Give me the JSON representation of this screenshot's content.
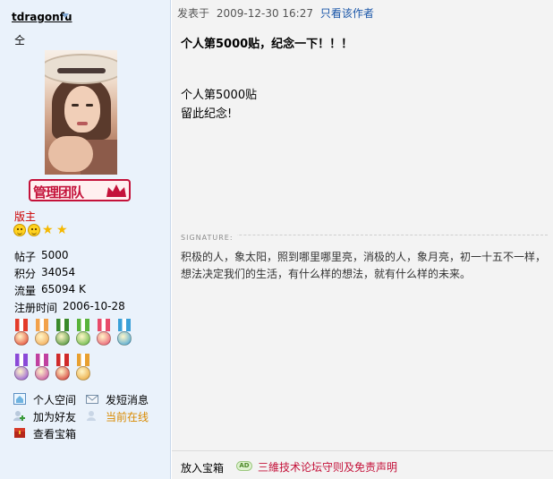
{
  "user": {
    "name": "tdragonfu",
    "status": "仝",
    "team_badge": "管理团队",
    "rank": "版主",
    "stats": [
      {
        "label": "帖子",
        "value": "5000"
      },
      {
        "label": "积分",
        "value": "34054"
      },
      {
        "label": "流量",
        "value": "65094 K"
      },
      {
        "label": "注册时间",
        "value": "2006-10-28"
      }
    ],
    "actions": [
      {
        "label": "个人空间",
        "icon": "home-icon"
      },
      {
        "label": "发短消息",
        "icon": "mail-icon"
      },
      {
        "label": "加为好友",
        "icon": "add-friend-icon"
      },
      {
        "label": "当前在线",
        "icon": "online-user-icon"
      },
      {
        "label": "查看宝箱",
        "icon": "treasure-box-icon"
      }
    ],
    "medals_row1": [
      "#e33b2a",
      "#f2a14a",
      "#3a8a2a",
      "#58b33a",
      "#e84a6a",
      "#3aa0d8"
    ],
    "medals_row2": [
      "#8a4ad8",
      "#c040a0",
      "#d02a2a",
      "#e8a030"
    ]
  },
  "post": {
    "meta_prefix": "发表于",
    "date": "2009-12-30 16:27",
    "only_author": "只看该作者",
    "title": "个人第5000贴，纪念一下！！！",
    "body_line1": "个人第5000贴",
    "body_line2": "留此纪念!",
    "signature_label": "SIGNATURE:",
    "signature_text": "积极的人，象太阳，照到哪里哪里亮，消极的人，象月亮，初一十五不一样，想法决定我们的生活，有什么样的想法，就有什么样的未来。"
  },
  "footer": {
    "left": "放入宝箱",
    "ad_badge": "AD",
    "ad_link": "三維技术论坛守则及免责声明"
  }
}
